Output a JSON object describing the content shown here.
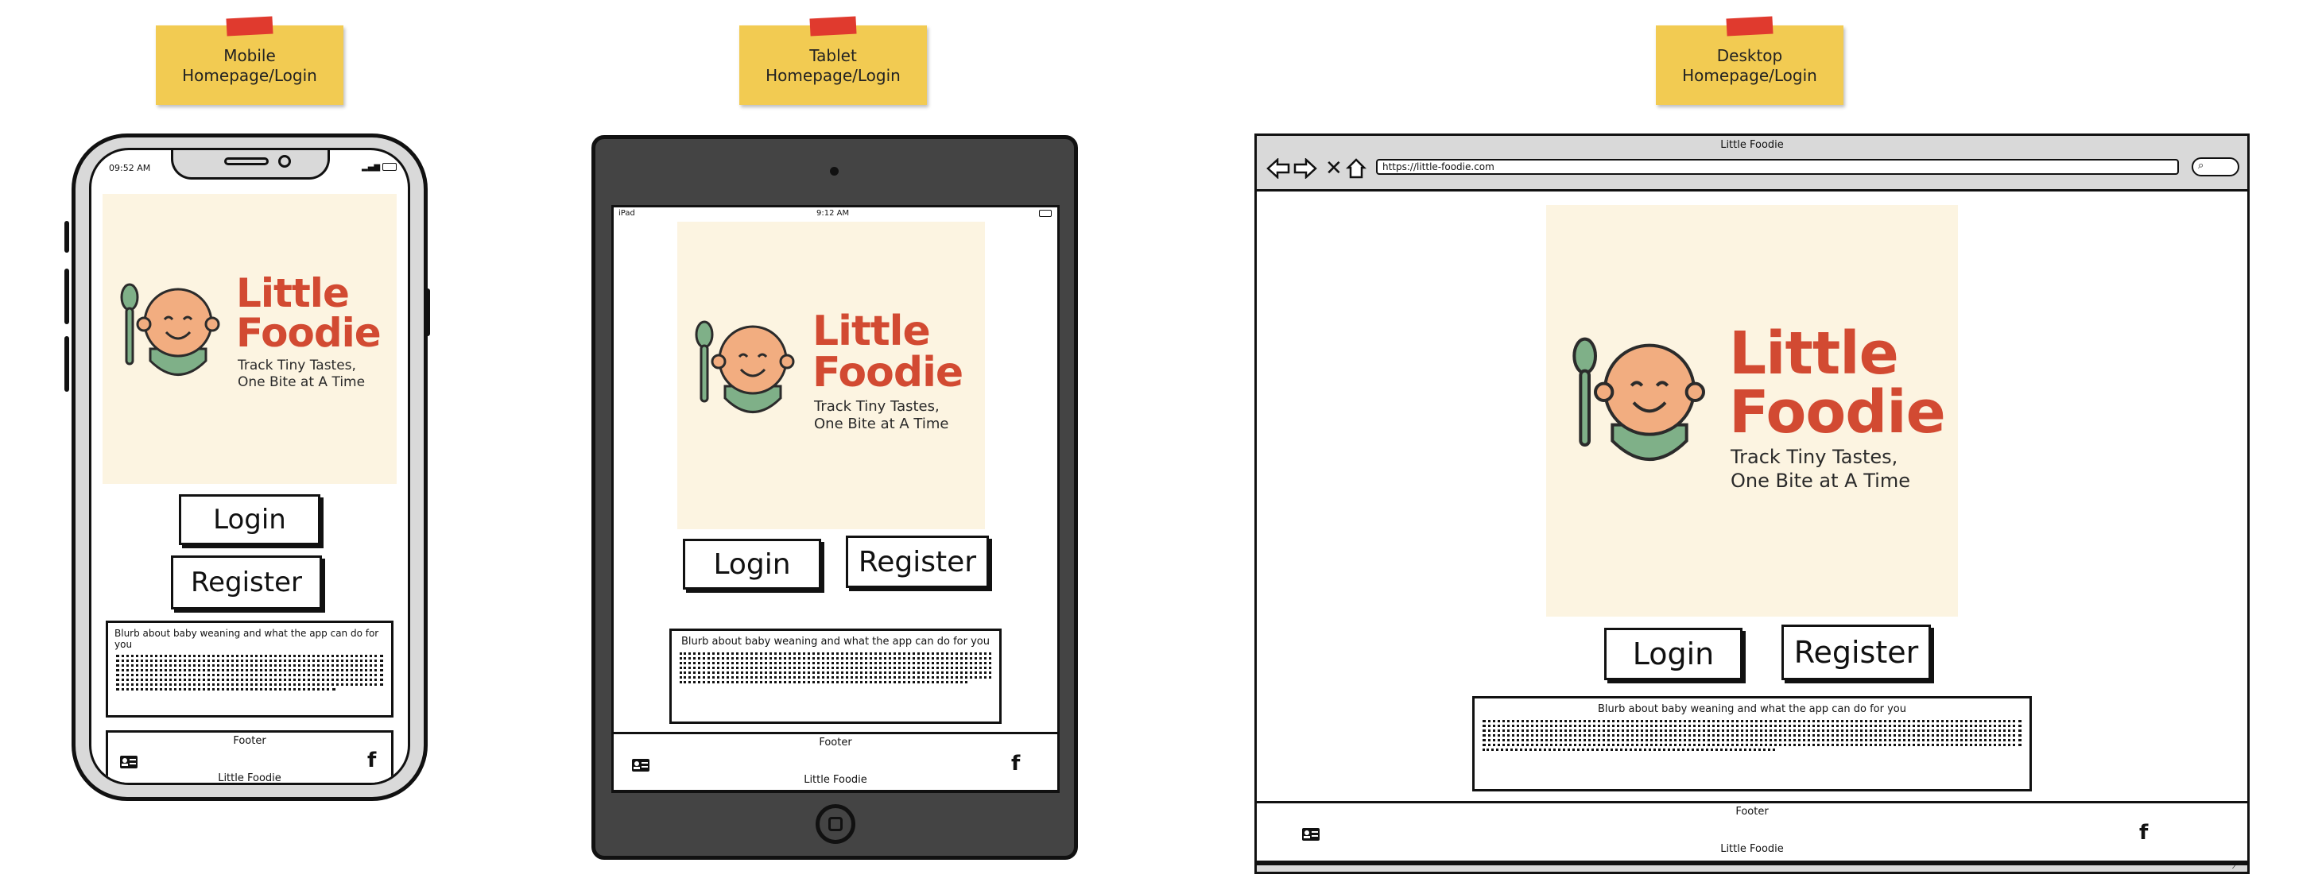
{
  "notes": {
    "mobile": {
      "line1": "Mobile",
      "line2": "Homepage/Login"
    },
    "tablet": {
      "line1": "Tablet",
      "line2": "Homepage/Login"
    },
    "desktop": {
      "line1": "Desktop",
      "line2": "Homepage/Login"
    }
  },
  "logo": {
    "title_line1": "Little",
    "title_line2": "Foodie",
    "tagline_line1": "Track Tiny Tastes,",
    "tagline_line2": "One Bite at A Time"
  },
  "buttons": {
    "login": "Login",
    "register": "Register"
  },
  "blurb": {
    "title": "Blurb about baby weaning and what the app can do for you"
  },
  "footer": {
    "label": "Footer",
    "brand": "Little Foodie"
  },
  "mobile": {
    "time": "09:52 AM"
  },
  "tablet": {
    "device": "iPad",
    "time": "9:12 AM"
  },
  "desktop": {
    "window_title": "Little Foodie",
    "url": "https://little-foodie.com"
  },
  "icons": {
    "contact": "contact-card-icon",
    "facebook": "facebook-icon",
    "back": "arrow-left-icon",
    "forward": "arrow-right-icon",
    "close": "close-icon",
    "home": "home-icon",
    "search": "search-icon"
  }
}
